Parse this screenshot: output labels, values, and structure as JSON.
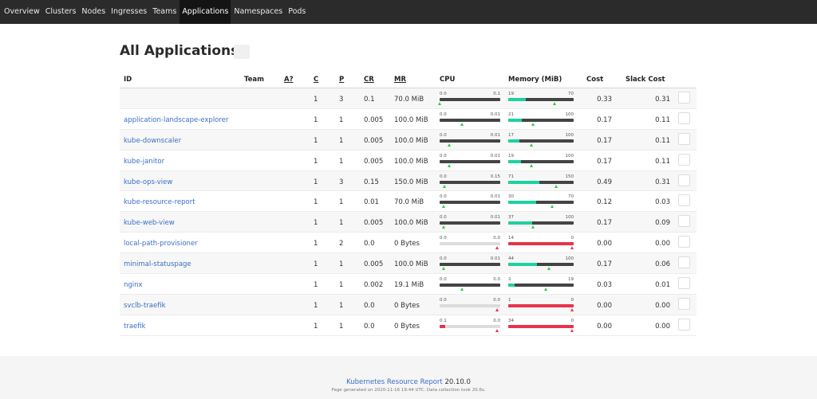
{
  "nav": {
    "items": [
      "Overview",
      "Clusters",
      "Nodes",
      "Ingresses",
      "Teams",
      "Applications",
      "Namespaces",
      "Pods"
    ],
    "active": "Applications"
  },
  "page": {
    "title": "All Applications"
  },
  "table": {
    "headers": {
      "id": "ID",
      "team": "Team",
      "active": "A?",
      "c": "C",
      "p": "P",
      "cr": "CR",
      "mr": "MR",
      "cpu": "CPU",
      "memory": "Memory (MiB)",
      "cost": "Cost",
      "slack": "Slack Cost"
    },
    "rows": [
      {
        "id": "",
        "team": "",
        "c": "1",
        "p": "3",
        "cr": "0.1",
        "mr": "70.0 MiB",
        "cpu": {
          "min": "0.0",
          "max": "0.1",
          "fill": 0.0,
          "mark": 0.0,
          "red": false
        },
        "mem": {
          "min": "19",
          "max": "70",
          "fill": 0.27,
          "mark": 0.71,
          "red": false
        },
        "cost": "0.33",
        "slack": "0.31"
      },
      {
        "id": "application-landscape-explorer",
        "team": "",
        "c": "1",
        "p": "1",
        "cr": "0.005",
        "mr": "100.0 MiB",
        "cpu": {
          "min": "0.0",
          "max": "0.01",
          "fill": 0.0,
          "mark": 0.38,
          "red": false
        },
        "mem": {
          "min": "21",
          "max": "100",
          "fill": 0.21,
          "mark": 0.38,
          "red": false
        },
        "cost": "0.17",
        "slack": "0.11"
      },
      {
        "id": "kube-downscaler",
        "team": "",
        "c": "1",
        "p": "1",
        "cr": "0.005",
        "mr": "100.0 MiB",
        "cpu": {
          "min": "0.0",
          "max": "0.01",
          "fill": 0.0,
          "mark": 0.17,
          "red": false
        },
        "mem": {
          "min": "17",
          "max": "100",
          "fill": 0.17,
          "mark": 0.36,
          "red": false
        },
        "cost": "0.17",
        "slack": "0.11"
      },
      {
        "id": "kube-janitor",
        "team": "",
        "c": "1",
        "p": "1",
        "cr": "0.005",
        "mr": "100.0 MiB",
        "cpu": {
          "min": "0.0",
          "max": "0.01",
          "fill": 0.0,
          "mark": 0.17,
          "red": false
        },
        "mem": {
          "min": "19",
          "max": "100",
          "fill": 0.19,
          "mark": 0.36,
          "red": false
        },
        "cost": "0.17",
        "slack": "0.11"
      },
      {
        "id": "kube-ops-view",
        "team": "",
        "c": "1",
        "p": "3",
        "cr": "0.15",
        "mr": "150.0 MiB",
        "cpu": {
          "min": "0.0",
          "max": "0.15",
          "fill": 0.0,
          "mark": 0.09,
          "red": false
        },
        "mem": {
          "min": "71",
          "max": "150",
          "fill": 0.47,
          "mark": 0.74,
          "red": false
        },
        "cost": "0.49",
        "slack": "0.31"
      },
      {
        "id": "kube-resource-report",
        "team": "",
        "c": "1",
        "p": "1",
        "cr": "0.01",
        "mr": "70.0 MiB",
        "cpu": {
          "min": "0.0",
          "max": "0.01",
          "fill": 0.0,
          "mark": 0.07,
          "red": false
        },
        "mem": {
          "min": "30",
          "max": "70",
          "fill": 0.43,
          "mark": 0.68,
          "red": false
        },
        "cost": "0.12",
        "slack": "0.03"
      },
      {
        "id": "kube-web-view",
        "team": "",
        "c": "1",
        "p": "1",
        "cr": "0.005",
        "mr": "100.0 MiB",
        "cpu": {
          "min": "0.0",
          "max": "0.01",
          "fill": 0.0,
          "mark": 0.07,
          "red": false
        },
        "mem": {
          "min": "37",
          "max": "100",
          "fill": 0.37,
          "mark": 0.38,
          "red": false
        },
        "cost": "0.17",
        "slack": "0.09"
      },
      {
        "id": "local-path-provisioner",
        "team": "",
        "c": "1",
        "p": "2",
        "cr": "0.0",
        "mr": "0 Bytes",
        "cpu": {
          "min": "0.0",
          "max": "0.0",
          "fill": 0.0,
          "mark": 0.96,
          "red": true
        },
        "mem": {
          "min": "14",
          "max": "0",
          "fill": 1.0,
          "mark": 0.98,
          "red": true
        },
        "cost": "0.00",
        "slack": "0.00"
      },
      {
        "id": "minimal-statuspage",
        "team": "",
        "c": "1",
        "p": "1",
        "cr": "0.005",
        "mr": "100.0 MiB",
        "cpu": {
          "min": "0.0",
          "max": "0.01",
          "fill": 0.0,
          "mark": 0.07,
          "red": false
        },
        "mem": {
          "min": "44",
          "max": "100",
          "fill": 0.44,
          "mark": 0.63,
          "red": false
        },
        "cost": "0.17",
        "slack": "0.06"
      },
      {
        "id": "nginx",
        "team": "",
        "c": "1",
        "p": "1",
        "cr": "0.002",
        "mr": "19.1 MiB",
        "cpu": {
          "min": "0.0",
          "max": "0.0",
          "fill": 0.0,
          "mark": 0.38,
          "red": false
        },
        "mem": {
          "min": "2",
          "max": "19",
          "fill": 0.1,
          "mark": 0.58,
          "red": false
        },
        "cost": "0.03",
        "slack": "0.01"
      },
      {
        "id": "svclb-traefik",
        "team": "",
        "c": "1",
        "p": "1",
        "cr": "0.0",
        "mr": "0 Bytes",
        "cpu": {
          "min": "0.0",
          "max": "0.0",
          "fill": 0.0,
          "mark": 0.96,
          "red": true
        },
        "mem": {
          "min": "1",
          "max": "0",
          "fill": 1.0,
          "mark": 0.98,
          "red": true
        },
        "cost": "0.00",
        "slack": "0.00"
      },
      {
        "id": "traefik",
        "team": "",
        "c": "1",
        "p": "1",
        "cr": "0.0",
        "mr": "0 Bytes",
        "cpu": {
          "min": "0.1",
          "max": "0.0",
          "fill": 0.09,
          "mark": 0.96,
          "red": true
        },
        "mem": {
          "min": "34",
          "max": "0",
          "fill": 1.0,
          "mark": 0.98,
          "red": true
        },
        "cost": "0.00",
        "slack": "0.00"
      }
    ]
  },
  "footer": {
    "name": "Kubernetes Resource Report",
    "version": "20.10.0",
    "subtitle": "Page generated on 2020-11-16 19:44 UTC. Data collection took 20.6s."
  },
  "colors": {
    "accent": "#3b6fc6",
    "usage_ok": "#1dd1a1",
    "usage_over": "#e8334a",
    "marker": "#2ecc40",
    "navbar": "#2b2b2b"
  }
}
